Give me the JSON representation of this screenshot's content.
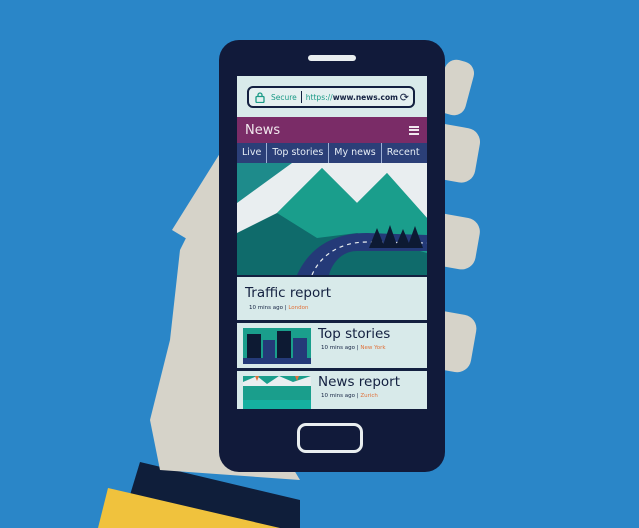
{
  "browser": {
    "secure_label": "Secure",
    "url_scheme": "https://",
    "url_domain": "www.news.com"
  },
  "app": {
    "title": "News"
  },
  "tabs": [
    "Live",
    "Top stories",
    "My news",
    "Recent"
  ],
  "stories": [
    {
      "title": "Traffic report",
      "time": "10 mins ago",
      "location": "London"
    },
    {
      "title": "Top stories",
      "time": "10 mins ago",
      "location": "New York"
    },
    {
      "title": "News report",
      "time": "10 mins ago",
      "location": "Zurich"
    }
  ],
  "icons": {
    "lock": "lock-icon",
    "reload": "reload-icon",
    "menu": "hamburger-menu-icon"
  },
  "colors": {
    "background": "#2a86c8",
    "phone": "#111a3a",
    "news_bar": "#7a2c67",
    "tabs_bar": "#2b3f78",
    "accent": "#1b9a86",
    "location": "#e0713a"
  }
}
